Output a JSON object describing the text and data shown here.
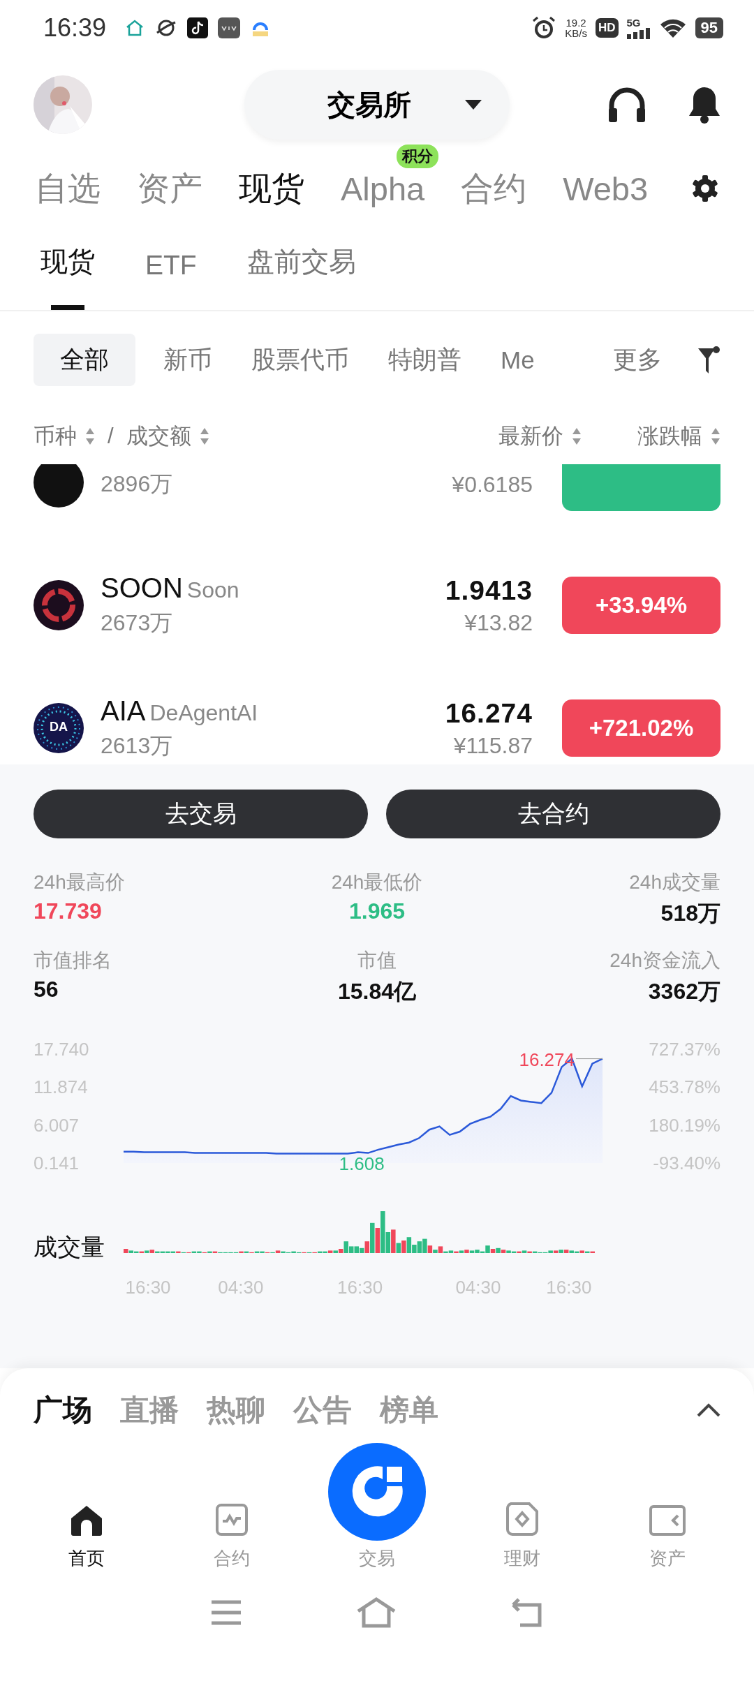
{
  "status_bar": {
    "time": "16:39",
    "net_speed": "19.2",
    "net_unit": "KB/s",
    "hd": "HD",
    "network": "5G",
    "battery": "95"
  },
  "header": {
    "title": "交易所"
  },
  "main_tabs": [
    {
      "label": "自选",
      "selected": false
    },
    {
      "label": "资产",
      "selected": false
    },
    {
      "label": "现货",
      "selected": true
    },
    {
      "label": "Alpha",
      "selected": false,
      "badge": "积分"
    },
    {
      "label": "合约",
      "selected": false
    },
    {
      "label": "Web3",
      "selected": false
    }
  ],
  "sub_tabs": [
    {
      "label": "现货",
      "selected": true
    },
    {
      "label": "ETF",
      "selected": false
    },
    {
      "label": "盘前交易",
      "selected": false
    }
  ],
  "filters": [
    {
      "label": "全部",
      "selected": true
    },
    {
      "label": "新币",
      "selected": false
    },
    {
      "label": "股票代币",
      "selected": false
    },
    {
      "label": "特朗普",
      "selected": false
    },
    {
      "label": "Me",
      "selected": false
    }
  ],
  "filter_more": "更多",
  "columns": {
    "coin": "币种",
    "separator": "/",
    "volume": "成交额",
    "price": "最新价",
    "change": "涨跌幅"
  },
  "rows": [
    {
      "volume": "2896万",
      "cny": "¥0.6185",
      "color": "#2dbd85"
    },
    {
      "symbol": "SOON",
      "name": "Soon",
      "volume": "2673万",
      "price": "1.9413",
      "cny": "¥13.82",
      "change": "+33.94%",
      "color": "#f0475a"
    },
    {
      "icon_text": "DA",
      "symbol": "AIA",
      "name": "DeAgentAI",
      "volume": "2613万",
      "price": "16.274",
      "cny": "¥115.87",
      "change": "+721.02%",
      "color": "#f0475a"
    }
  ],
  "actions": [
    "去交易",
    "去合约"
  ],
  "stats": [
    {
      "label": "24h最高价",
      "value": "17.739",
      "color": "#f0475a"
    },
    {
      "label": "24h最低价",
      "value": "1.965",
      "color": "#2dbd85"
    },
    {
      "label": "24h成交量",
      "value": "518万",
      "color": "#111111"
    },
    {
      "label": "市值排名",
      "value": "56",
      "color": "#111111"
    },
    {
      "label": "市值",
      "value": "15.84亿",
      "color": "#111111"
    },
    {
      "label": "24h资金流入",
      "value": "3362万",
      "color": "#111111"
    }
  ],
  "chart": {
    "right_axis": [
      "727.37%",
      "453.78%",
      "180.19%",
      "-93.40%"
    ],
    "volume_label": "成交量",
    "time_labels": [
      "16:30",
      "04:30",
      "16:30",
      "04:30",
      "16:30"
    ],
    "chart_data": {
      "type": "area",
      "ylim": [
        0.141,
        17.74
      ],
      "yticks": [
        {
          "value": 17.74,
          "label": "17.740"
        },
        {
          "value": 11.874,
          "label": "11.874"
        },
        {
          "value": 6.007,
          "label": "6.007"
        },
        {
          "value": 0.141,
          "label": "0.141"
        }
      ],
      "series": [
        {
          "color": "#2b59d9",
          "values": [
            1.9,
            1.9,
            1.8,
            1.8,
            1.8,
            1.8,
            1.8,
            1.7,
            1.7,
            1.7,
            1.7,
            1.7,
            1.7,
            1.7,
            1.7,
            1.6,
            1.6,
            1.6,
            1.6,
            1.6,
            1.6,
            1.6,
            1.608,
            1.8,
            1.7,
            2.2,
            2.6,
            3.0,
            3.3,
            4.0,
            5.3,
            5.8,
            4.5,
            5.0,
            6.2,
            6.8,
            7.3,
            8.5,
            10.5,
            9.8,
            9.6,
            9.4,
            11.0,
            15.0,
            16.3,
            12.0,
            15.5,
            16.274
          ]
        }
      ],
      "annotations": [
        "16.274",
        "1.608"
      ]
    }
  },
  "feed_tabs": [
    {
      "label": "广场",
      "selected": true
    },
    {
      "label": "直播",
      "selected": false
    },
    {
      "label": "热聊",
      "selected": false
    },
    {
      "label": "公告",
      "selected": false
    },
    {
      "label": "榜单",
      "selected": false
    }
  ],
  "nav": [
    {
      "label": "首页",
      "selected": true
    },
    {
      "label": "合约",
      "selected": false
    },
    {
      "label": "交易",
      "selected": false
    },
    {
      "label": "理财",
      "selected": false
    },
    {
      "label": "资产",
      "selected": false
    }
  ]
}
